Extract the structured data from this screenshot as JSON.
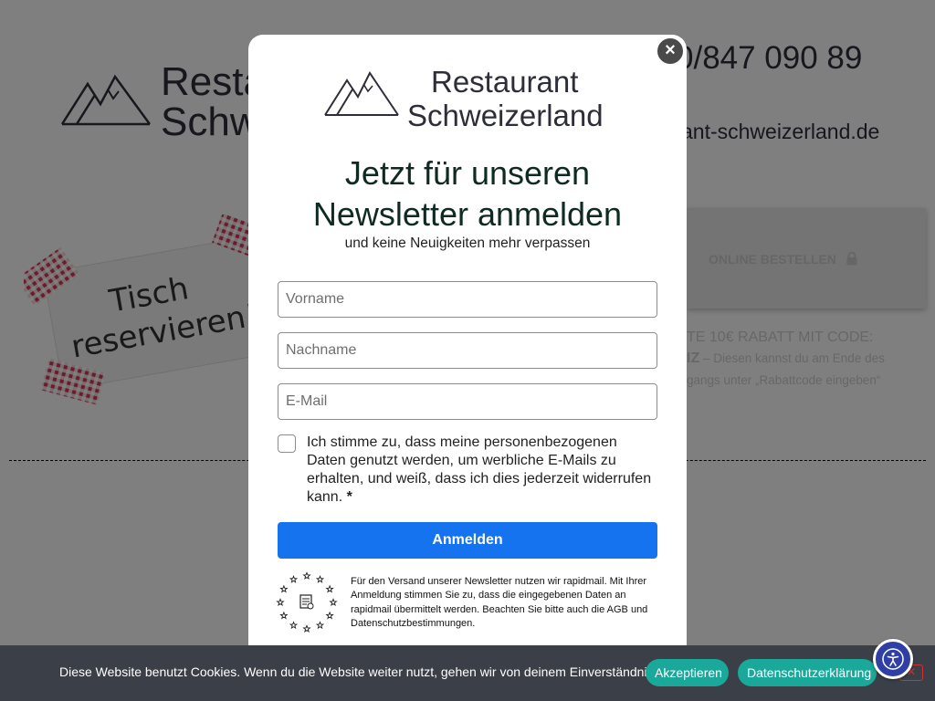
{
  "background": {
    "brand_line1": "Restaurant",
    "brand_line2": "Schweizerland",
    "phone": "0/847 090 89",
    "email": "ant-schweizerland.de",
    "sign_line1": "Tisch",
    "sign_line2": "reservieren!",
    "order_button": "ONLINE BESTELLEN",
    "discount_line1": "TE 10€ RABATT MIT CODE:",
    "discount_code": "IZ",
    "discount_text": " – Diesen kannst du am Ende des",
    "discount_line3": "gangs unter „Rabattcode eingeben“"
  },
  "modal": {
    "brand_line1": "Restaurant",
    "brand_line2": "Schweizerland",
    "title_line1": "Jetzt für unseren",
    "title_line2": "Newsletter anmelden",
    "subtitle": "und keine Neuigkeiten mehr verpassen",
    "fields": {
      "firstname_placeholder": "Vorname",
      "lastname_placeholder": "Nachname",
      "email_placeholder": "E-Mail"
    },
    "consent_text": "Ich stimme zu, dass meine personenbezogenen Daten genutzt werden, um werbliche E-Mails zu erhalten, und weiß, dass ich dies jederzeit widerrufen kann.",
    "consent_required_mark": "*",
    "submit_label": "Anmelden",
    "legal_text": "Für den Versand unserer Newsletter nutzen wir rapidmail. Mit Ihrer Anmeldung stimmen Sie zu, dass die eingegebenen Daten an rapidmail übermittelt werden. Beachten Sie bitte auch die AGB und Datenschutzbestimmungen.",
    "close_label": "×"
  },
  "cookie_bar": {
    "text": "Diese Website benutzt Cookies. Wenn du die Website weiter nutzt, gehen wir von deinem Einverständnis aus.",
    "accept_label": "Akzeptieren",
    "privacy_label": "Datenschutzerklärung",
    "close_label": "✕"
  },
  "icons": {
    "mountain_logo": "mountain-logo-icon",
    "lock": "lock-icon",
    "eu_badge": "eu-stars-badge-icon",
    "accessibility": "accessibility-icon",
    "close": "close-icon"
  },
  "colors": {
    "primary_button": "#1673f0",
    "cookie_bar": "#3b3f47",
    "cookie_buttons": "#1aa89a",
    "accessibility_button": "#2f3fa6",
    "title": "#0e2a22"
  }
}
